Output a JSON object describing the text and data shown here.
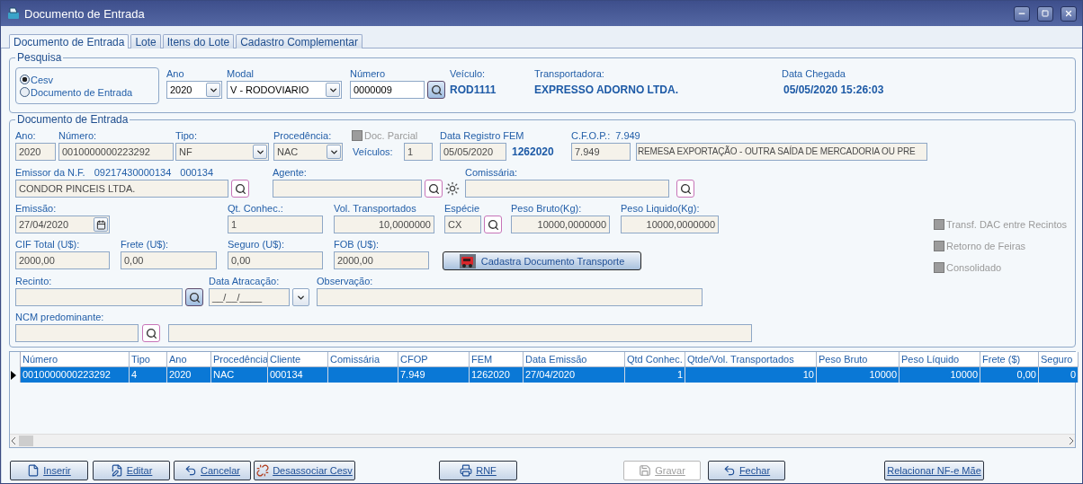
{
  "window": {
    "title": "Documento de Entrada"
  },
  "tabs": [
    {
      "label": "Documento de Entrada",
      "selected": true
    },
    {
      "label": "Lote",
      "selected": false
    },
    {
      "label": "Itens do Lote",
      "selected": false
    },
    {
      "label": "Cadastro Complementar",
      "selected": false
    }
  ],
  "pesquisa": {
    "title": "Pesquisa",
    "radios": [
      {
        "label": "Cesv",
        "selected": true
      },
      {
        "label": "Documento de Entrada",
        "selected": false
      }
    ],
    "ano": {
      "label": "Ano",
      "value": "2020"
    },
    "modal": {
      "label": "Modal",
      "value": "V - RODOVIARIO"
    },
    "numero": {
      "label": "Número",
      "value": "0000009"
    },
    "veiculo": {
      "label": "Veículo:",
      "value": "ROD1111"
    },
    "transportadora": {
      "label": "Transportadora:",
      "value": "EXPRESSO ADORNO LTDA."
    },
    "data_chegada": {
      "label": "Data Chegada",
      "value": "05/05/2020 15:26:03"
    }
  },
  "documento": {
    "title": "Documento de Entrada",
    "ano": {
      "label": "Ano:",
      "value": "2020"
    },
    "numero": {
      "label": "Número:",
      "value": "0010000000223292"
    },
    "tipo": {
      "label": "Tipo:",
      "value": "NF"
    },
    "procedencia": {
      "label": "Procedência:",
      "value": "NAC"
    },
    "doc_parcial": {
      "label": "Doc. Parcial",
      "checked": false,
      "disabled": true
    },
    "veiculos": {
      "label": "Veículos:",
      "value": "1"
    },
    "data_registro_fem": {
      "label": "Data Registro FEM",
      "value": "05/05/2020",
      "fem": "1262020"
    },
    "cfop": {
      "label": "C.F.O.P.:",
      "code": "7.949",
      "value": "7.949",
      "description": "REMESA EXPORTAÇÃO - OUTRA SAÍDA DE MERCADORIA OU PRE"
    },
    "emissor": {
      "label": "Emissor da N.F.",
      "cnpj": "09217430000134",
      "code": "000134",
      "value": "CONDOR PINCEIS LTDA."
    },
    "agente": {
      "label": "Agente:"
    },
    "comissaria": {
      "label": "Comissária:"
    },
    "emissao": {
      "label": "Emissão:",
      "value": "27/04/2020"
    },
    "qt_conhec": {
      "label": "Qt. Conhec.:",
      "value": "1"
    },
    "vol_transportados": {
      "label": "Vol. Transportados",
      "value": "10,0000000"
    },
    "especie": {
      "label": "Espécie",
      "value": "CX"
    },
    "peso_bruto": {
      "label": "Peso Bruto(Kg):",
      "value": "10000,0000000"
    },
    "peso_liquido": {
      "label": "Peso Liquido(Kg):",
      "value": "10000,0000000"
    },
    "cif_total": {
      "label": "CIF Total (U$):",
      "value": "2000,00"
    },
    "frete": {
      "label": "Frete (U$):",
      "value": "0,00"
    },
    "seguro": {
      "label": "Seguro (U$):",
      "value": "0,00"
    },
    "fob": {
      "label": "FOB (U$):",
      "value": "2000,00"
    },
    "cadastra_button": "Cadastra Documento Transporte",
    "recinto": {
      "label": "Recinto:"
    },
    "data_atracacao": {
      "label": "Data Atracação:",
      "value": "__/__/____"
    },
    "observacao": {
      "label": "Observação:"
    },
    "ncm": {
      "label": "NCM predominante:"
    },
    "flags": [
      {
        "label": "Transf. DAC entre Recintos",
        "checked": false,
        "disabled": true
      },
      {
        "label": "Retorno de Feiras",
        "checked": false,
        "disabled": true
      },
      {
        "label": "Consolidado",
        "checked": false,
        "disabled": true
      }
    ]
  },
  "grid": {
    "columns": [
      {
        "label": "Número",
        "kind": "text"
      },
      {
        "label": "Tipo",
        "kind": "text"
      },
      {
        "label": "Ano",
        "kind": "text"
      },
      {
        "label": "Procedência",
        "kind": "text"
      },
      {
        "label": "Cliente",
        "kind": "text"
      },
      {
        "label": "Comissária",
        "kind": "text"
      },
      {
        "label": "CFOP",
        "kind": "text"
      },
      {
        "label": "FEM",
        "kind": "text"
      },
      {
        "label": "Data Emissão",
        "kind": "text"
      },
      {
        "label": "Qtd Conhec.",
        "kind": "number"
      },
      {
        "label": "Qtde/Vol. Transportados",
        "kind": "number"
      },
      {
        "label": "Peso Bruto",
        "kind": "number"
      },
      {
        "label": "Peso Líquido",
        "kind": "number"
      },
      {
        "label": "Frete ($)",
        "kind": "number"
      },
      {
        "label": "Seguro",
        "kind": "number"
      }
    ],
    "rows": [
      {
        "selected": true,
        "cells": [
          "0010000000223292",
          "4",
          "2020",
          "NAC",
          "000134",
          "",
          "7.949",
          "1262020",
          "27/04/2020",
          "1",
          "10",
          "10000",
          "10000",
          "0,00",
          "0"
        ]
      }
    ]
  },
  "buttons": [
    {
      "label": "Inserir",
      "disabled": false,
      "kind": "new"
    },
    {
      "label": "Editar",
      "disabled": false,
      "kind": "edit"
    },
    {
      "label": "Cancelar",
      "disabled": false,
      "kind": "cancel"
    },
    {
      "label": "Desassociar Cesv",
      "disabled": false,
      "kind": "unlink"
    },
    {
      "label": "RNF",
      "disabled": false,
      "kind": "print"
    },
    {
      "label": "Gravar",
      "disabled": true,
      "kind": "save"
    },
    {
      "label": "Fechar",
      "disabled": false,
      "kind": "close"
    },
    {
      "label": "Relacionar NF-e Mãe",
      "disabled": false,
      "kind": "plain"
    }
  ]
}
